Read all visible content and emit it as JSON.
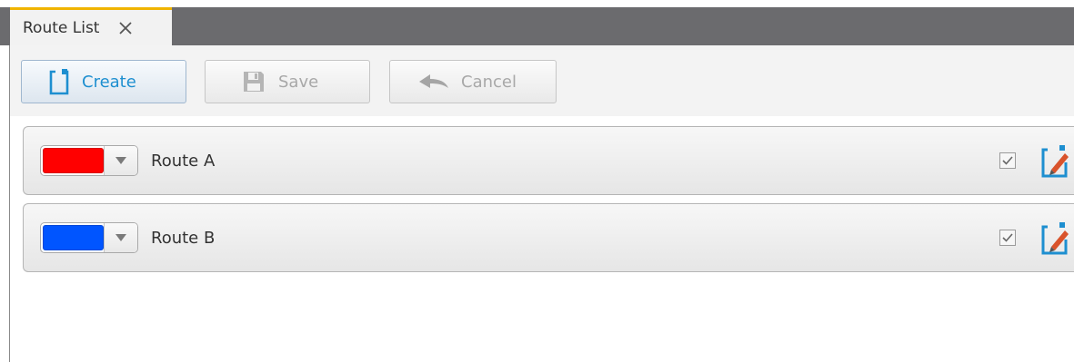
{
  "tab": {
    "label": "Route List",
    "close_icon": "close-icon"
  },
  "toolbar": {
    "create_label": "Create",
    "save_label": "Save",
    "cancel_label": "Cancel",
    "icons": {
      "create": "create-icon",
      "save": "floppy-disk-icon",
      "cancel": "undo-arrow-icon"
    }
  },
  "routes": [
    {
      "name": "Route A",
      "color": "#ff0000",
      "visible": true,
      "edit_icon": "edit-icon"
    },
    {
      "name": "Route B",
      "color": "#0055ff",
      "visible": true,
      "edit_icon": "edit-icon"
    }
  ],
  "colors": {
    "accent": "#1e8fd0",
    "tab_bar": "#6b6b6e",
    "tab_highlight": "#f0b400",
    "disabled_text": "#a8a8a8"
  }
}
